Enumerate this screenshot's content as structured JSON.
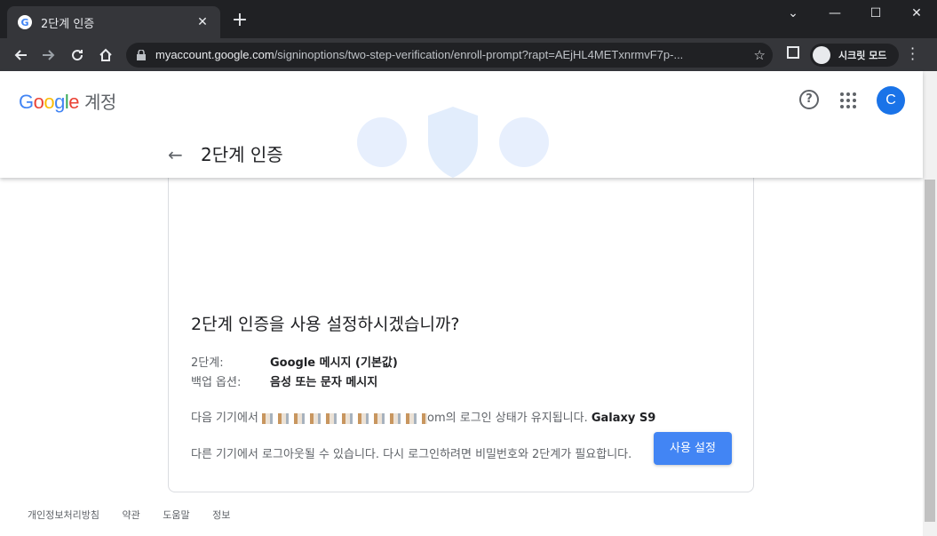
{
  "browser": {
    "tab_title": "2단계 인증",
    "tab_close": "✕",
    "new_tab": "+",
    "url_host": "myaccount.google.com",
    "url_path": "/signinoptions/two-step-verification/enroll-prompt?rapt=AEjHL4METxnrmvF7p-...",
    "incognito_label": "시크릿 모드",
    "min_glyph": "—",
    "max_glyph": "☐",
    "close_glyph": "✕",
    "dropdown_glyph": "⌄"
  },
  "header": {
    "logo_g": "G",
    "logo_o1": "o",
    "logo_o2": "o",
    "logo_g2": "g",
    "logo_l": "l",
    "logo_e": "e",
    "logo_account": "계정",
    "help": "?",
    "avatar_initial": "C",
    "back": "←",
    "page_title": "2단계 인증"
  },
  "card": {
    "question": "2단계 인증을 사용 설정하시겠습니까?",
    "step_label": "2단계:",
    "step_value": "Google 메시지 (기본값)",
    "backup_label": "백업 옵션:",
    "backup_value": "음성 또는 문자 메시지",
    "device_prefix": "다음 기기에서",
    "device_suffix": "om의 로그인 상태가 유지됩니다.",
    "device_name": "Galaxy S9",
    "signout_text": "다른 기기에서 로그아웃될 수 있습니다. 다시 로그인하려면 비밀번호와 2단계가 필요합니다.",
    "enable_button": "사용 설정"
  },
  "footer": {
    "links": [
      "개인정보처리방침",
      "약관",
      "도움말",
      "정보"
    ]
  },
  "colors": {
    "accent": "#4285f4",
    "avatar": "#1a73e8",
    "chrome_dark": "#202124"
  }
}
